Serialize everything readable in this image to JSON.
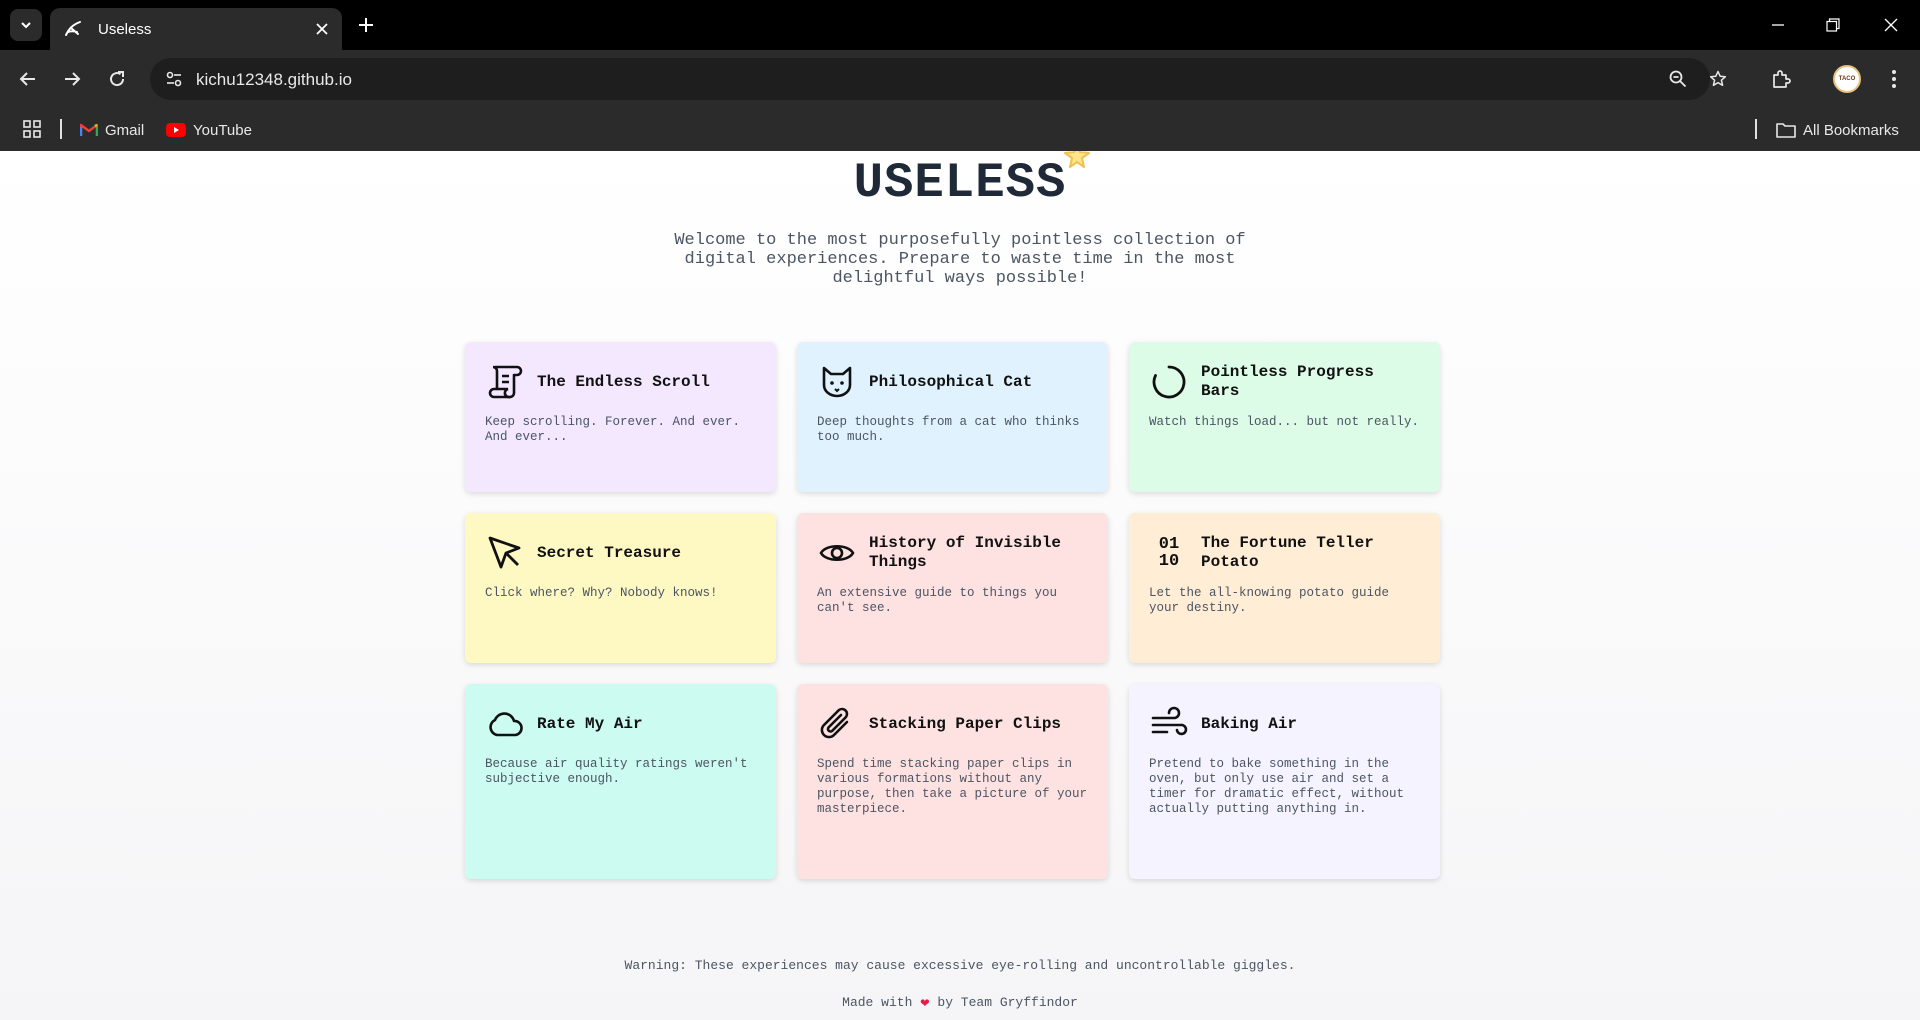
{
  "browser": {
    "tab_title": "Useless",
    "url": "kichu12348.github.io",
    "avatar_text": "TACO",
    "bookmarks": [
      {
        "label": "Gmail",
        "icon": "gmail-icon"
      },
      {
        "label": "YouTube",
        "icon": "youtube-icon"
      }
    ],
    "all_bookmarks_label": "All Bookmarks"
  },
  "page": {
    "title": "USELESS",
    "subtitle": "Welcome to the most purposefully pointless collection of digital experiences. Prepare to waste time in the most delightful ways possible!",
    "cards": [
      {
        "title": "The Endless Scroll",
        "description": "Keep scrolling. Forever. And ever. And ever...",
        "icon": "scroll-icon",
        "color": "#f3e8ff"
      },
      {
        "title": "Philosophical Cat",
        "description": "Deep thoughts from a cat who thinks too much.",
        "icon": "cat-icon",
        "color": "#e0f2fe"
      },
      {
        "title": "Pointless Progress Bars",
        "description": "Watch things load... but not really.",
        "icon": "loader-icon",
        "color": "#dcfce7"
      },
      {
        "title": "Secret Treasure",
        "description": "Click where? Why? Nobody knows!",
        "icon": "cursor-icon",
        "color": "#fef9c3"
      },
      {
        "title": "History of Invisible Things",
        "description": "An extensive guide to things you can't see.",
        "icon": "eye-icon",
        "color": "#fee2e2"
      },
      {
        "title": "The Fortune Teller Potato",
        "description": "Let the all-knowing potato guide your destiny.",
        "icon": "binary-icon",
        "icon_text_1": "01",
        "icon_text_2": "10",
        "color": "#ffedd5"
      },
      {
        "title": "Rate My Air",
        "description": "Because air quality ratings weren't subjective enough.",
        "icon": "cloud-icon",
        "color": "#ccfbf1"
      },
      {
        "title": "Stacking Paper Clips",
        "description": "Spend time stacking paper clips in various formations without any purpose, then take a picture of your masterpiece.",
        "icon": "paperclip-icon",
        "color": "#fee2e2"
      },
      {
        "title": "Baking Air",
        "description": "Pretend to bake something in the oven, but only use air and set a timer for dramatic effect, without actually putting anything in.",
        "icon": "wind-icon",
        "color": "#f5f3ff"
      }
    ],
    "footer_warning": "Warning: These experiences may cause excessive eye-rolling and uncontrollable giggles.",
    "footer_made_prefix": "Made with",
    "footer_made_suffix": "by Team Gryffindor"
  }
}
